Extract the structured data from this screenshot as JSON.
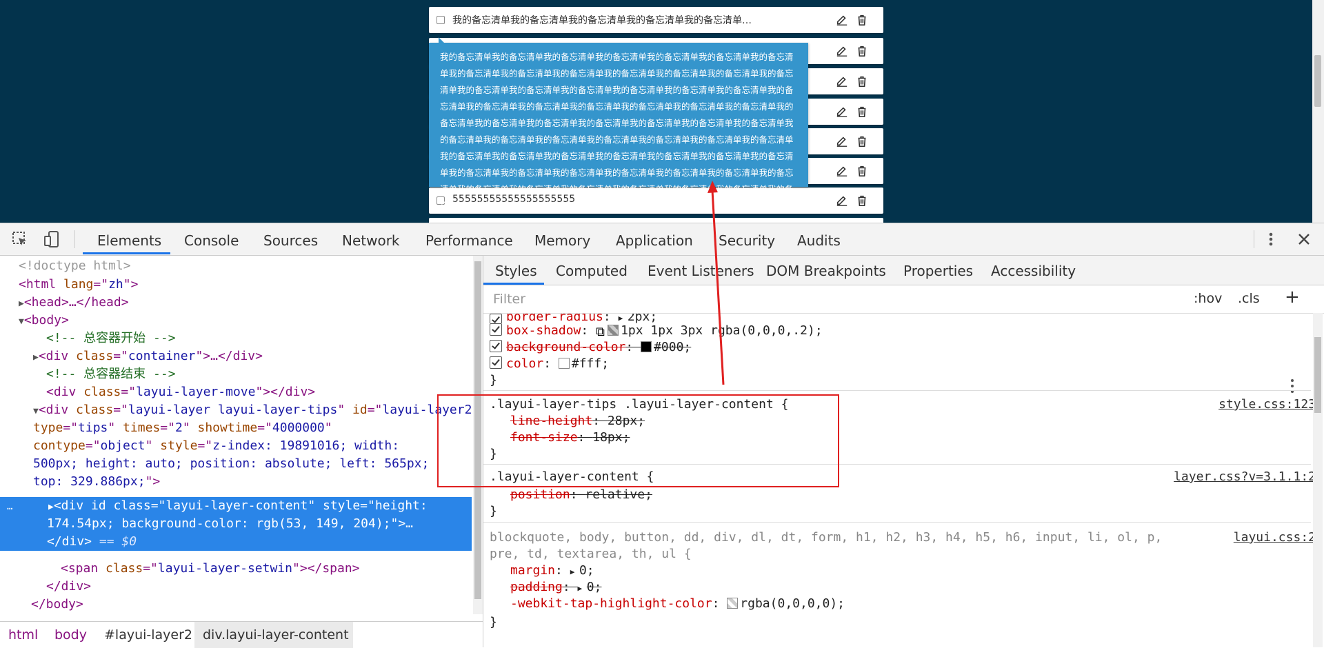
{
  "page": {
    "notes": [
      {
        "text": "我的备忘清单我的备忘清单我的备忘清单我的备忘清单我的备忘清单…"
      },
      {
        "text": ""
      },
      {
        "text": ""
      },
      {
        "text": ""
      },
      {
        "text": ""
      },
      {
        "text": ""
      },
      {
        "text": "55555555555555555555"
      }
    ],
    "tip_text": "我的备忘清单我的备忘清单我的备忘清单我的备忘清单我的备忘清单我的备忘清单我的备忘清单我的备忘清单我的备忘清单我的备忘清单我的备忘清单我的备忘清单我的备忘清单我的备忘清单我的备忘清单我的备忘清单我的备忘清单我的备忘清单我的备忘清单我的备忘清单我的备忘清单我的备忘清单我的备忘清单我的备忘清单我的备忘清单我的备忘清单我的备忘清单我的备忘清单我的备忘清单我的备忘清单我的备忘清单我的备忘清单我的备忘清单我的备忘清单我的备忘清单我的备忘清单我的备忘清单我的备忘清单我的备忘清单我的备忘清单我的备忘清单我的备忘清单我的备忘清单我的备忘清单我的备忘清单我的备忘清单我的备忘清单我的备忘清单我的备忘清单我的备忘清单我的备忘清单我的备忘清单我的备忘清单我的备忘清单我的备忘清单我的备忘清单我的备忘清单我的备忘清单我的备忘清单我的备忘清单我的备忘清单我的备忘清单我的备忘清单我的备忘清单",
    "tip_bg": "#3595cc",
    "bg": "#03334c"
  },
  "devtools": {
    "tabs": [
      "Elements",
      "Console",
      "Sources",
      "Network",
      "Performance",
      "Memory",
      "Application",
      "Security",
      "Audits"
    ],
    "active_tab": "Elements",
    "elements": {
      "doctype": "<!doctype html>",
      "html_open": {
        "tag": "html",
        "attr": "lang",
        "val": "zh"
      },
      "head": "<head>…</head>",
      "body_open": "<body>",
      "comment1": "<!-- 总容器开始 -->",
      "container": {
        "class": "container"
      },
      "comment2": "<!-- 总容器结束 -->",
      "layer_move": {
        "class": "layui-layer-move"
      },
      "layer_div": {
        "class": "layui-layer layui-layer-tips",
        "id": "layui-layer2",
        "type": "tips",
        "times": "2",
        "showtime": "4000000",
        "contype": "object",
        "style_l1": "z-index: 19891016; width:",
        "style_l2": "500px; height: auto; position: absolute; left: 565px;",
        "style_l3": "top: 329.886px;"
      },
      "selected": {
        "class": "layui-layer-content",
        "style_l1": "height:",
        "style_l2": "174.54px; background-color: rgb(53, 149, 204);",
        "dollar": "== $0"
      },
      "setwin": {
        "class": "layui-layer-setwin"
      },
      "close_div": "</div>",
      "close_body": "</body>"
    },
    "breadcrumbs": [
      "html",
      "body",
      "#layui-layer2",
      "div.layui-layer-content"
    ],
    "styles": {
      "subtabs": [
        "Styles",
        "Computed",
        "Event Listeners",
        "DOM Breakpoints",
        "Properties",
        "Accessibility"
      ],
      "filter_placeholder": "Filter",
      "hov": ":hov",
      "cls": ".cls",
      "plus": "+",
      "rule0": {
        "props": [
          {
            "name": "border-radius",
            "value": "2px;"
          },
          {
            "name": "box-shadow",
            "value": "1px 1px 3px rgba(0,0,0,.2);"
          },
          {
            "name": "background-color",
            "value": "#000;"
          },
          {
            "name": "color",
            "value": "#fff;"
          }
        ]
      },
      "rule1": {
        "selector": ".layui-layer-tips .layui-layer-content {",
        "source": "style.css:123",
        "props": [
          {
            "name": "line-height",
            "value": "28px;"
          },
          {
            "name": "font-size",
            "value": "18px;"
          }
        ]
      },
      "rule2": {
        "selector": ".layui-layer-content {",
        "source": "layer.css?v=3.1.1:2",
        "props": [
          {
            "name": "position",
            "value": "relative;"
          }
        ]
      },
      "rule3": {
        "selector_l1": "blockquote, body, button, dd, div, dl, dt, form, h1, h2, h3, h4, h5, h6, input, li, ol, p,",
        "selector_l2": "pre, td, textarea, th, ul {",
        "source": "layui.css:2",
        "props": [
          {
            "name": "margin",
            "value": "0;"
          },
          {
            "name": "padding",
            "value": "0;"
          },
          {
            "name": "-webkit-tap-highlight-color",
            "value": "rgba(0,0,0,0);"
          }
        ]
      },
      "close_brace": "}"
    }
  },
  "colors": {
    "accent": "#1a73e8",
    "annotation": "#e02020",
    "selection": "#2a85e8"
  }
}
